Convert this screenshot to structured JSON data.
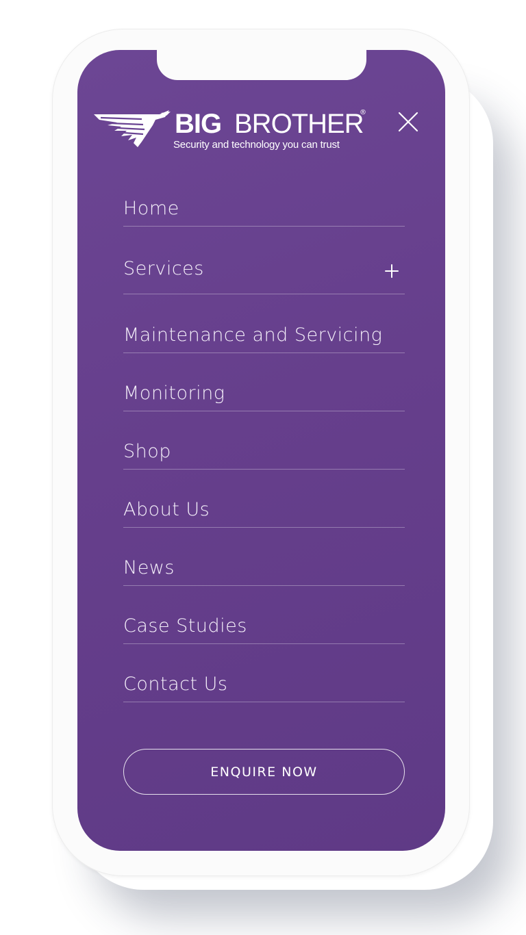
{
  "brand": {
    "name_bold": "BIG",
    "name_light": "BROTHER",
    "registered": "®",
    "tagline": "Security and technology you can trust",
    "logo_icon": "eagle-wing-icon"
  },
  "header": {
    "close_icon": "close-icon"
  },
  "menu": {
    "items": [
      {
        "label": "Home"
      },
      {
        "label": "Services",
        "expand_icon": "plus-icon"
      },
      {
        "label": "Maintenance and Servicing"
      },
      {
        "label": "Monitoring"
      },
      {
        "label": "Shop"
      },
      {
        "label": "About Us"
      },
      {
        "label": "News"
      },
      {
        "label": "Case Studies"
      },
      {
        "label": "Contact Us"
      }
    ]
  },
  "cta": {
    "label": "ENQUIRE NOW"
  },
  "colors": {
    "background": "#663f8c",
    "text": "#ffffff",
    "device": "#fbfbfb"
  }
}
